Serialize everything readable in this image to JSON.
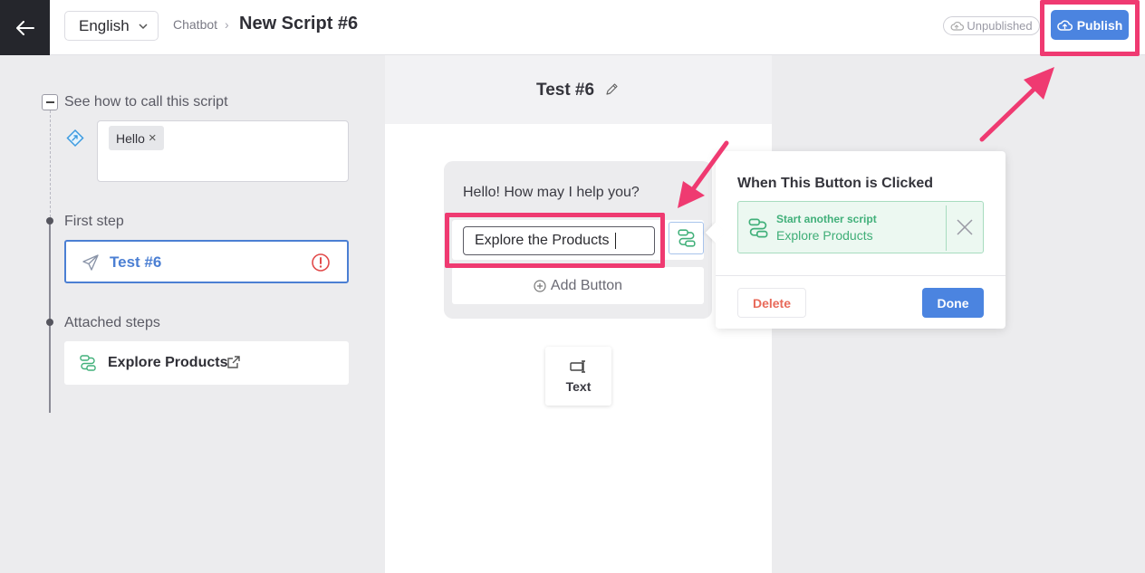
{
  "header": {
    "language": "English",
    "breadcrumb": "Chatbot",
    "breadcrumb_sep": "›",
    "title": "New Script #6",
    "status": "Unpublished",
    "publish_label": "Publish"
  },
  "sidebar": {
    "trigger_label": "See how to call this script",
    "trigger_chips": [
      "Hello"
    ],
    "first_step_label": "First step",
    "first_step_name": "Test #6",
    "attached_label": "Attached steps",
    "attached_name": "Explore Products"
  },
  "editor": {
    "title": "Test #6",
    "message": "Hello! How may I help you?",
    "button_value": "Explore the Products",
    "add_button_label": "Add Button",
    "text_tool_label": "Text"
  },
  "popover": {
    "title": "When This Button is Clicked",
    "action_type": "Start another script",
    "action_target": "Explore Products",
    "delete_label": "Delete",
    "done_label": "Done"
  },
  "colors": {
    "accent": "#4b84e0",
    "highlight": "#ef3a71",
    "success": "#41b07a",
    "danger": "#e86a5a"
  }
}
